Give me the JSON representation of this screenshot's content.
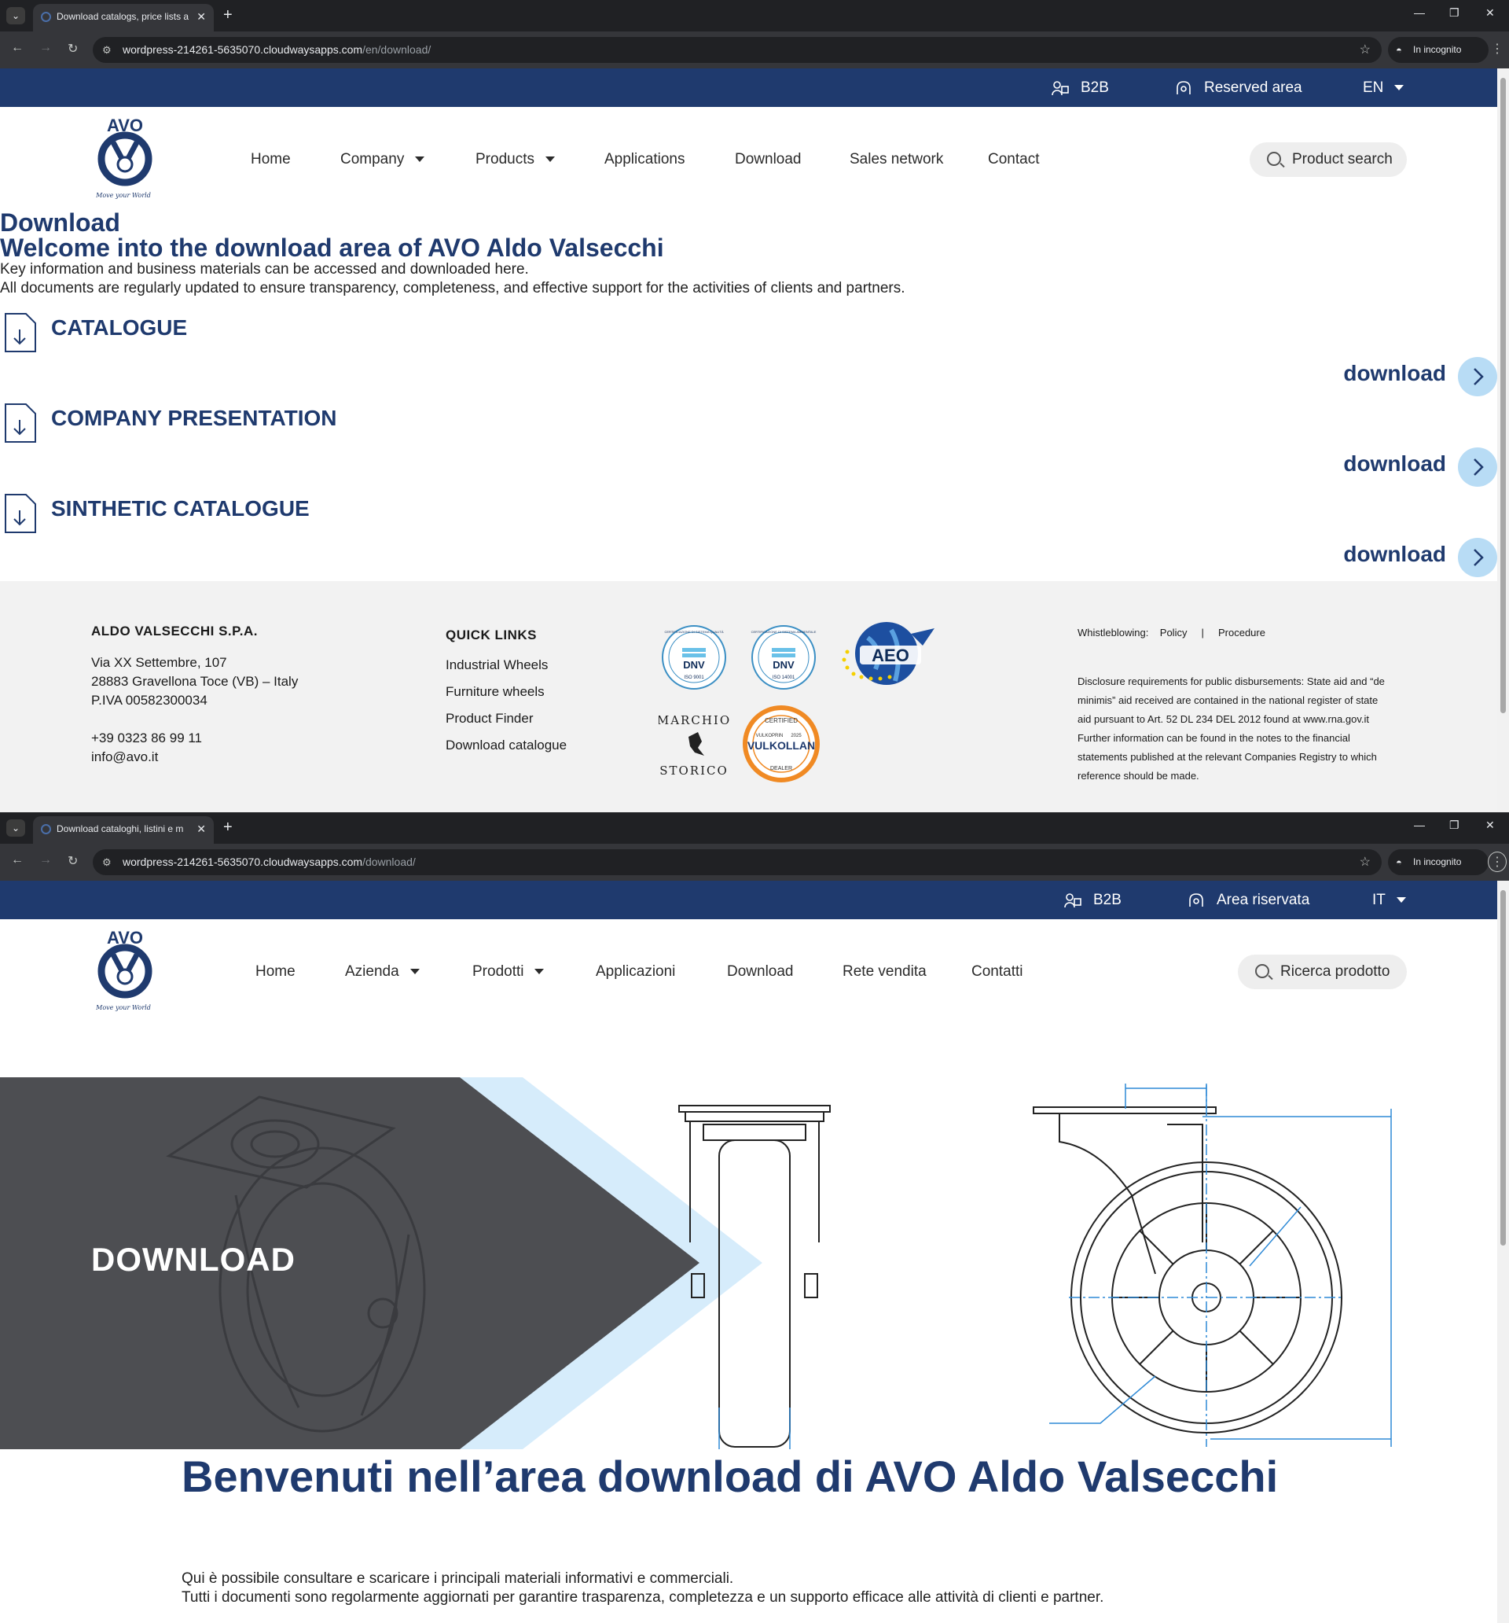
{
  "window1": {
    "tab_title": "Download catalogs, price lists a",
    "url_host": "wordpress-214261-5635070.cloudwaysapps.com",
    "url_path": "/en/download/",
    "incognito_label": "In incognito",
    "topbar": {
      "b2b": "B2B",
      "reserved": "Reserved area",
      "lang": "EN"
    },
    "nav": [
      "Home",
      "Company",
      "Products",
      "Applications",
      "Download",
      "Sales network",
      "Contact"
    ],
    "search_placeholder": "Product search",
    "heading1": "Download",
    "heading2": "Welcome into the download area of AVO Aldo Valsecchi",
    "para1": "Key information and business materials can be accessed and downloaded here.",
    "para2": "All documents are regularly updated to ensure transparency, completeness, and effective support for the activities of clients and partners.",
    "downloads": [
      {
        "title": "CATALOGUE",
        "link": "download"
      },
      {
        "title": "COMPANY PRESENTATION",
        "link": "download"
      },
      {
        "title": "SINTHETIC CATALOGUE",
        "link": "download"
      }
    ],
    "footer": {
      "company": "ALDO VALSECCHI S.P.A.",
      "address1": "Via XX Settembre, 107",
      "address2": "28883 Gravellona Toce (VB) – Italy",
      "vat": "P.IVA 00582300034",
      "phone": "+39 0323 86 99 11",
      "email": "info@avo.it",
      "quick_links_title": "QUICK LINKS",
      "quick_links": [
        "Industrial Wheels",
        "Furniture wheels",
        "Product Finder",
        "Download catalogue"
      ],
      "whistle_label": "Whistleblowing:",
      "whistle_policy": "Policy",
      "whistle_sep": "|",
      "whistle_procedure": "Procedure",
      "disclosure": [
        "Disclosure requirements for public disbursements: State aid and “de",
        "minimis” aid received are contained in the national register of state",
        "aid pursuant to Art. 52 DL 234 DEL 2012 found at www.rna.gov.it",
        "Further information can be found in the notes to the financial",
        "statements published at the relevant Companies Registry to which",
        "reference should be made."
      ],
      "badges": {
        "dnv": "DNV",
        "iso9001": "ISO 9001",
        "iso14001": "ISO 14001",
        "cert_quality": "CERTIFICAZIONE DI SISTEMA QUALITÀ",
        "cert_env": "CERTIFICAZIONE DI SISTEMA AMBIENTALE",
        "aeo": "AEO",
        "marchio": "MARCHIO",
        "storico": "STORICO",
        "certified": "CERTIFIED",
        "vulkoprin": "VULKOPRIN",
        "year": "2025",
        "vulkollan": "VULKOLLAN",
        "dealer": "DEALER"
      }
    }
  },
  "window2": {
    "tab_title": "Download cataloghi, listini e m",
    "url_host": "wordpress-214261-5635070.cloudwaysapps.com",
    "url_path": "/download/",
    "incognito_label": "In incognito",
    "topbar": {
      "b2b": "B2B",
      "reserved": "Area riservata",
      "lang": "IT"
    },
    "nav": [
      "Home",
      "Azienda",
      "Prodotti",
      "Applicazioni",
      "Download",
      "Rete vendita",
      "Contatti"
    ],
    "search_placeholder": "Ricerca prodotto",
    "hero_title": "DOWNLOAD",
    "heading": "Benvenuti nell’area download di AVO Aldo Valsecchi",
    "para1": "Qui è possibile consultare e scaricare i principali materiali informativi e commerciali.",
    "para2": "Tutti i documenti sono regolarmente aggiornati per garantire trasparenza, completezza e un supporto efficace alle attività di clienti e partner."
  },
  "logo": {
    "text": "AVO",
    "tagline": "Move your World"
  },
  "colors": {
    "navy": "#1f3a6e",
    "light_blue": "#b8dcf5",
    "footer_bg": "#f2f2f2",
    "hero_dark": "#4d4e52"
  }
}
